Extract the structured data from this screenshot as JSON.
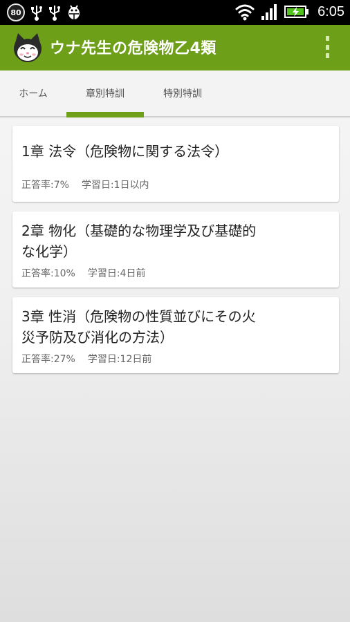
{
  "statusbar": {
    "notification_badge": "80",
    "time": "6:05",
    "icons": [
      "usb-icon",
      "usb-icon",
      "android-debug-icon",
      "wifi-icon",
      "signal-icon",
      "battery-charging-icon"
    ]
  },
  "app": {
    "title": "ウナ先生の危険物乙4類",
    "icon": "cat-mascot-icon",
    "accent_color": "#6e9f18"
  },
  "tabs": [
    {
      "label": "ホーム",
      "selected": false
    },
    {
      "label": "章別特訓",
      "selected": true
    },
    {
      "label": "特別特訓",
      "selected": false
    }
  ],
  "chapters": [
    {
      "title": "1章 法令（危険物に関する法令）",
      "accuracy": "正答率:7%",
      "study_date": "学習日:1日以内"
    },
    {
      "title": "2章 物化（基礎的な物理学及び基礎的\nな化学）",
      "accuracy": "正答率:10%",
      "study_date": "学習日:4日前"
    },
    {
      "title": "3章 性消（危険物の性質並びにその火\n災予防及び消化の方法）",
      "accuracy": "正答率:27%",
      "study_date": "学習日:12日前"
    }
  ]
}
